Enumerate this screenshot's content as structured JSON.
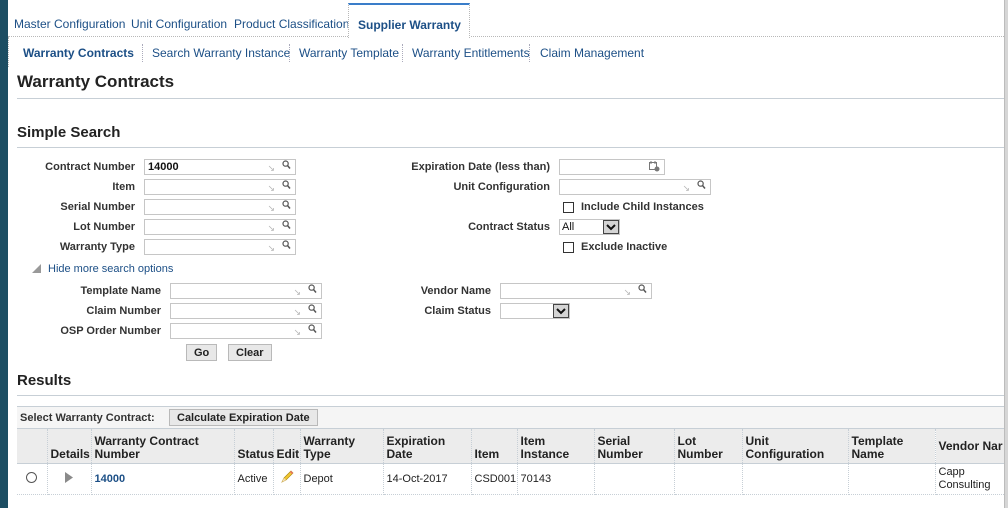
{
  "top_tabs": [
    {
      "label": "Master Configuration",
      "active": false
    },
    {
      "label": "Unit Configuration",
      "active": false
    },
    {
      "label": "Product Classification",
      "active": false
    },
    {
      "label": "Supplier Warranty",
      "active": true
    }
  ],
  "sub_tabs": [
    {
      "label": "Warranty Contracts",
      "active": true
    },
    {
      "label": "Search Warranty Instance",
      "active": false
    },
    {
      "label": "Warranty Template",
      "active": false
    },
    {
      "label": "Warranty Entitlements",
      "active": false
    },
    {
      "label": "Claim Management",
      "active": false
    }
  ],
  "page_title": "Warranty Contracts",
  "search": {
    "heading": "Simple Search",
    "left_fields": [
      {
        "label": "Contract Number",
        "value": "14000"
      },
      {
        "label": "Item",
        "value": ""
      },
      {
        "label": "Serial Number",
        "value": ""
      },
      {
        "label": "Lot Number",
        "value": ""
      },
      {
        "label": "Warranty Type",
        "value": ""
      }
    ],
    "expiration_label": "Expiration Date (less than)",
    "expiration_value": "",
    "unit_config_label": "Unit Configuration",
    "unit_config_value": "",
    "include_child_label": "Include Child Instances",
    "include_child_checked": false,
    "contract_status_label": "Contract Status",
    "contract_status_value": "All",
    "exclude_inactive_label": "Exclude Inactive",
    "exclude_inactive_checked": false,
    "hide_options_label": "Hide more search options",
    "more_fields": [
      {
        "label": "Template Name",
        "value": ""
      },
      {
        "label": "Claim Number",
        "value": ""
      },
      {
        "label": "OSP Order Number",
        "value": ""
      }
    ],
    "vendor_name_label": "Vendor Name",
    "vendor_name_value": "",
    "claim_status_label": "Claim Status",
    "claim_status_value": "",
    "go_label": "Go",
    "clear_label": "Clear"
  },
  "results": {
    "heading": "Results",
    "select_label": "Select Warranty Contract:",
    "calc_button": "Calculate Expiration Date",
    "columns": [
      "",
      "Details",
      "Warranty Contract Number",
      "Status",
      "Edit",
      "Warranty Type",
      "Expiration Date",
      "Item",
      "Item Instance",
      "Serial Number",
      "Lot Number",
      "Unit Configuration",
      "Template Name",
      "Vendor Nar"
    ],
    "rows": [
      {
        "contract_number": "14000",
        "status": "Active",
        "warranty_type": "Depot",
        "expiration_date": "14-Oct-2017",
        "item": "CSD001",
        "item_instance": "70143",
        "serial_number": "",
        "lot_number": "",
        "unit_configuration": "",
        "template_name": "",
        "vendor_name": "Capp Consulting"
      }
    ]
  }
}
